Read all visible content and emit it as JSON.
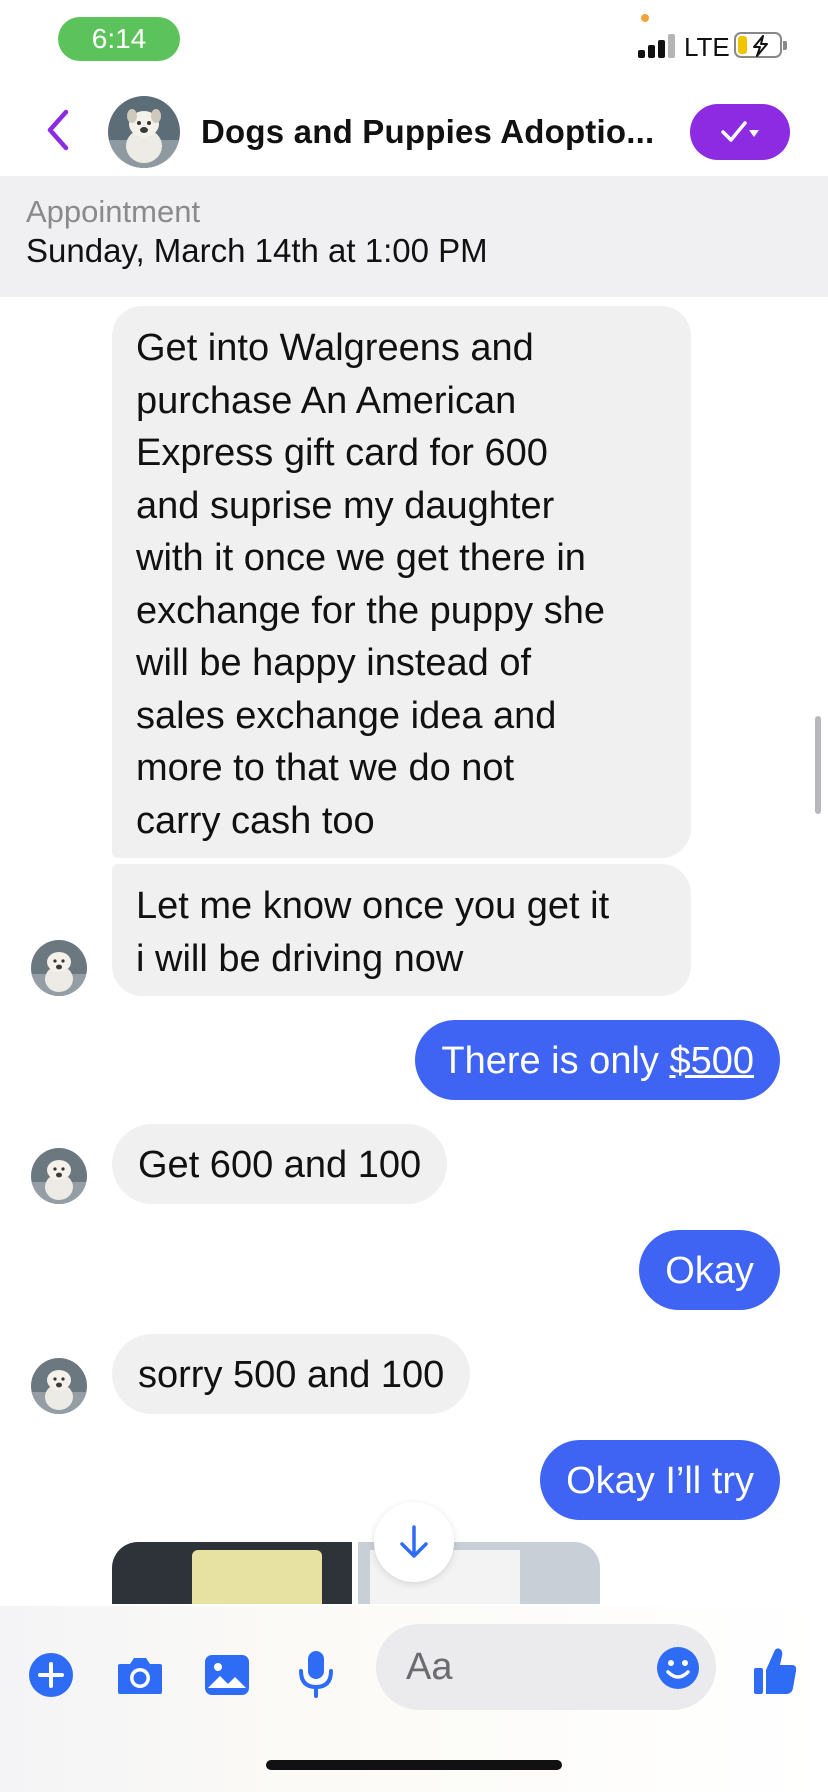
{
  "status_bar": {
    "time": "6:14",
    "network": "LTE",
    "icons": [
      "signal-icon",
      "battery-charging-icon"
    ]
  },
  "header": {
    "title": "Dogs  and Puppies  Adoptio...",
    "icons": [
      "back-chevron-icon",
      "checkmark-dropdown-icon"
    ],
    "accent_color": "#8c2be2"
  },
  "appointment": {
    "label": "Appointment",
    "value": "Sunday, March 14th at 1:00 PM"
  },
  "messages": [
    {
      "direction": "incoming",
      "lines": [
        "Get into Walgreens and",
        "purchase An American",
        "Express gift card for 600",
        "and suprise my daughter",
        "with it once we get there in",
        "exchange for the puppy she",
        "will be happy instead of",
        "sales exchange idea and",
        "more to that we do not",
        "carry cash too"
      ]
    },
    {
      "direction": "incoming",
      "lines": [
        "Let me know once you get it",
        "i will be driving now"
      ]
    },
    {
      "direction": "outgoing",
      "text": "There is only ",
      "link": "$500"
    },
    {
      "direction": "incoming",
      "text": "Get 600 and 100"
    },
    {
      "direction": "outgoing",
      "text": "Okay"
    },
    {
      "direction": "incoming",
      "text": "sorry 500 and 100"
    },
    {
      "direction": "outgoing",
      "text": "Okay I’ll try"
    }
  ],
  "colors": {
    "outgoing_bubble": "#3f63f2",
    "incoming_bubble": "#f0f0f0",
    "icon_blue": "#2f6cf5"
  },
  "composer": {
    "placeholder": "Aa",
    "icons": [
      "plus-icon",
      "camera-icon",
      "image-icon",
      "microphone-icon",
      "emoji-icon",
      "thumbs-up-icon"
    ]
  }
}
